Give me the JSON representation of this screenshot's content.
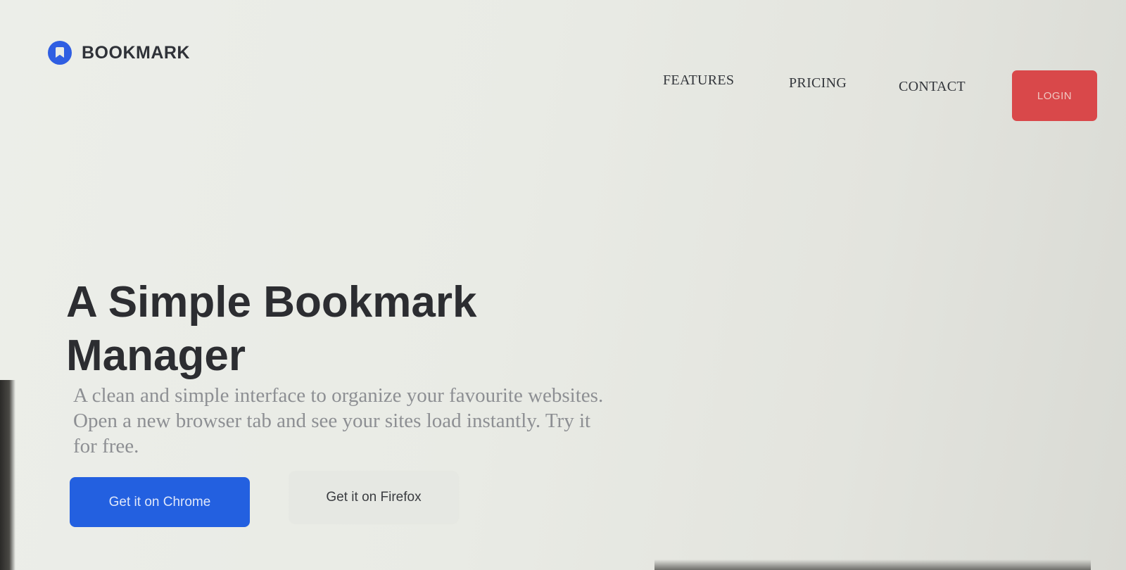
{
  "brand": {
    "name": "BOOKMARK",
    "icon": "bookmark-logo-icon",
    "color": "#2f5ee2"
  },
  "nav": {
    "features": "FEATURES",
    "pricing": "PRICING",
    "contact": "CONTACT",
    "login": "LOGIN",
    "login_color": "#d9484a"
  },
  "hero": {
    "title": "A Simple Bookmark Manager",
    "description": "A clean and simple interface to organize your favourite websites. Open a new browser tab and see your sites load instantly. Try it for free.",
    "cta_chrome": "Get it on Chrome",
    "cta_firefox": "Get it on Firefox",
    "cta_chrome_color": "#2360e0"
  }
}
